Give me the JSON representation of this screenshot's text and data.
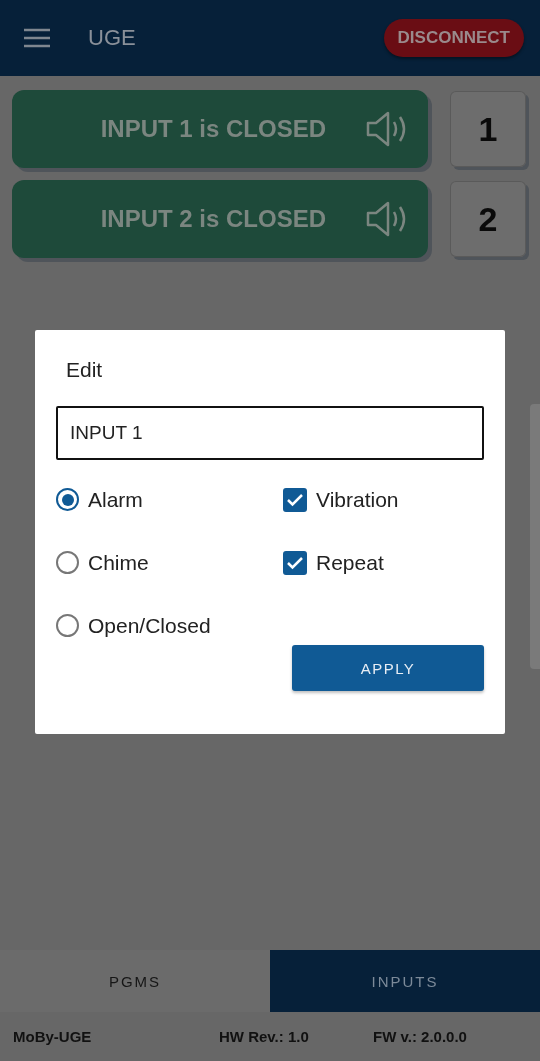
{
  "app_bar": {
    "title": "UGE",
    "disconnect_button": "DISCONNECT"
  },
  "inputs": [
    {
      "label": "INPUT 1 is CLOSED",
      "number": "1"
    },
    {
      "label": "INPUT 2 is CLOSED",
      "number": "2"
    }
  ],
  "dialog": {
    "title": "Edit",
    "name_field": {
      "value": "INPUT 1"
    },
    "sound_options": [
      {
        "label": "Alarm",
        "selected": true
      },
      {
        "label": "Chime",
        "selected": false
      },
      {
        "label": "Open/Closed",
        "selected": false
      }
    ],
    "flags": [
      {
        "label": "Vibration",
        "checked": true
      },
      {
        "label": "Repeat",
        "checked": true
      }
    ],
    "apply_button": "APPLY"
  },
  "tabs": [
    {
      "label": "PGMS",
      "selected": false
    },
    {
      "label": "INPUTS",
      "selected": true
    }
  ],
  "status_bar": {
    "device": "MoBy-UGE",
    "hw_rev": "HW Rev.: 1.0",
    "fw_version": "FW v.: 2.0.0.0"
  }
}
